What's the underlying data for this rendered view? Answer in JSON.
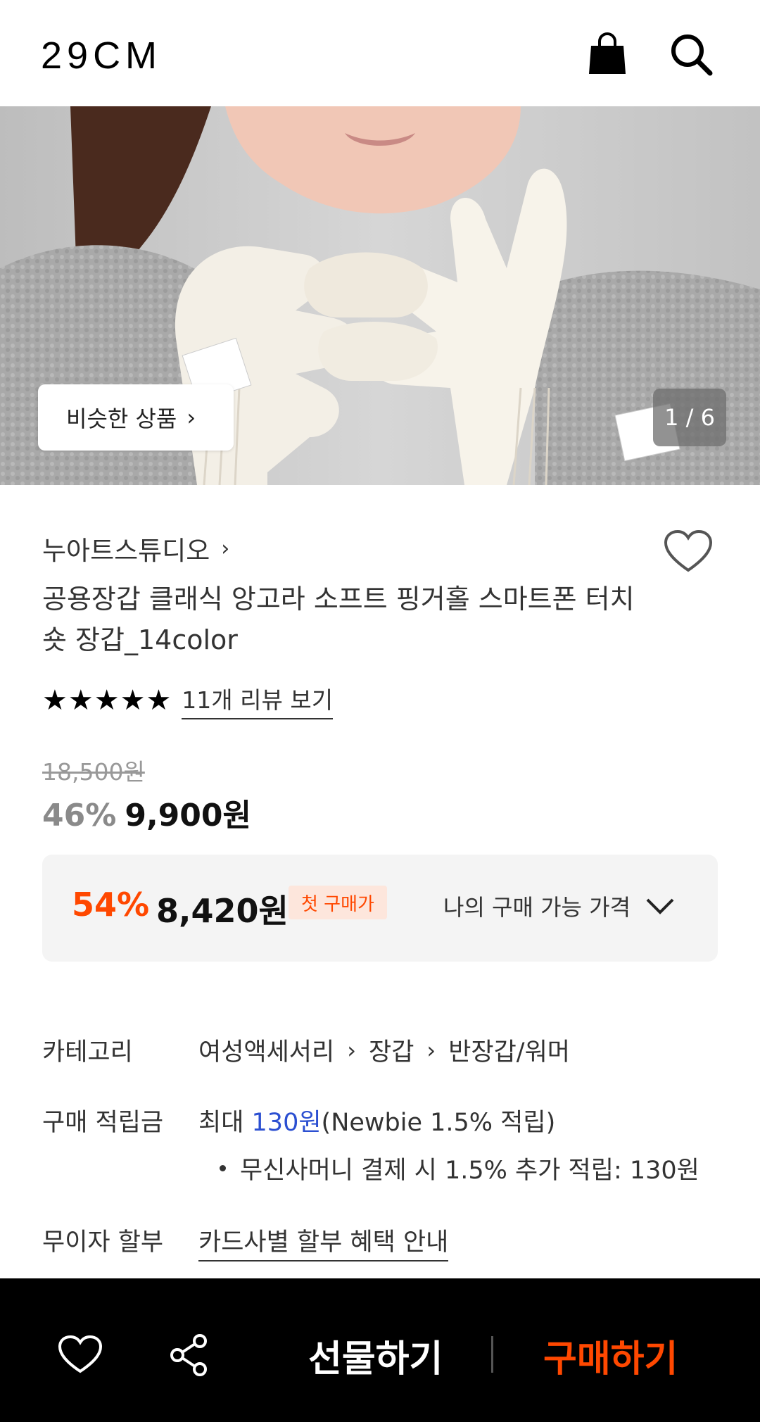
{
  "header": {
    "logo": "29CM",
    "cart_icon": "shopping-bag-icon",
    "search_icon": "search-icon"
  },
  "hero": {
    "similar_label": "비슷한 상품",
    "page_indicator": "1 / 6"
  },
  "product": {
    "brand": "누아트스튜디오",
    "title": "공용장갑 클래식 앙고라 소프트 핑거홀 스마트폰 터치 숏 장갑_14color",
    "stars": "★★★★★",
    "rating": 5,
    "review_link": "11개 리뷰 보기",
    "original_price": "18,500원",
    "discount": "46%",
    "sale_price": "9,900원"
  },
  "best_price": {
    "discount": "54%",
    "price": "8,420원",
    "badge": "첫 구매가",
    "my_price_label": "나의 구매 가능 가격"
  },
  "details": {
    "category_label": "카테고리",
    "categories": [
      "여성액세서리",
      "장갑",
      "반장갑/워머"
    ],
    "points_label": "구매 적립금",
    "points_prefix": "최대 ",
    "points_amount": "130원",
    "points_suffix": "(Newbie 1.5% 적립)",
    "points_extra": "무신사머니 결제 시 1.5% 추가 적립: 130원",
    "installment_label": "무이자 할부",
    "installment_link": "카드사별 할부 혜택 안내"
  },
  "bottom_bar": {
    "gift_label": "선물하기",
    "buy_label": "구매하기"
  },
  "colors": {
    "accent": "#ff4800",
    "point_blue": "#2b4fd1",
    "bottom_bar_bg": "#000000"
  }
}
